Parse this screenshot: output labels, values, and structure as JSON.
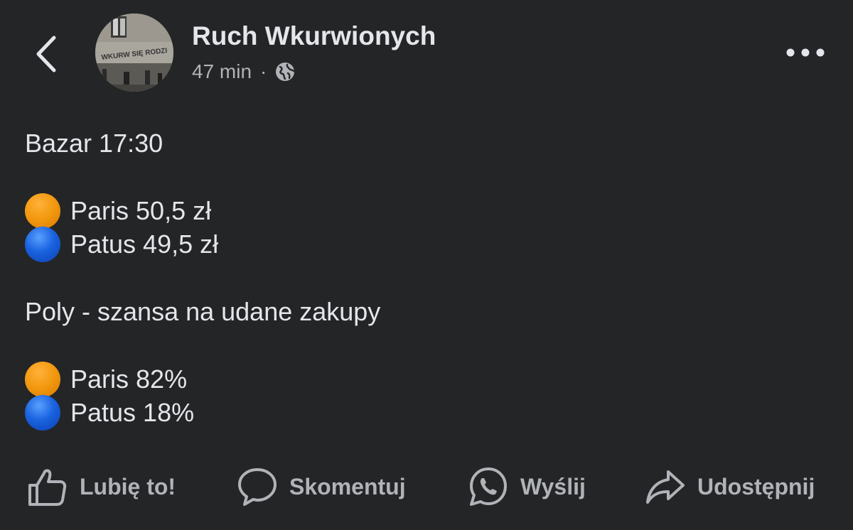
{
  "header": {
    "author": "Ruch Wkurwionych",
    "time": "47 min",
    "separator": "·",
    "avatar_text": "WKURW SIĘ RODZI",
    "icons": {
      "back": "chevron-left-icon",
      "privacy": "globe-icon",
      "more": "more-horizontal-icon"
    }
  },
  "post": {
    "line1": "Bazar 17:30",
    "price_items": [
      {
        "color": "orange",
        "label": "Paris 50,5 zł"
      },
      {
        "color": "blue",
        "label": "Patus 49,5 zł"
      }
    ],
    "line2": "Poly - szansa na udane zakupy",
    "chance_items": [
      {
        "color": "orange",
        "label": "Paris 82%"
      },
      {
        "color": "blue",
        "label": "Patus 18%"
      }
    ]
  },
  "actions": {
    "like": "Lubię to!",
    "comment": "Skomentuj",
    "send": "Wyślij",
    "share": "Udostępnij"
  },
  "colors": {
    "background": "#242526",
    "text": "#e4e6eb",
    "secondary_text": "#b0b3b8",
    "orange_dot": "#f39a11",
    "blue_dot": "#1a63e0"
  }
}
